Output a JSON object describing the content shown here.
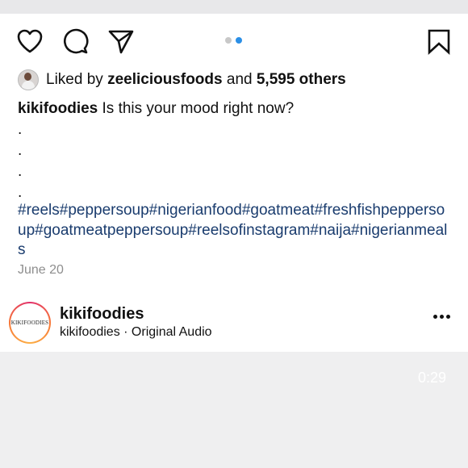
{
  "post": {
    "liked_prefix": "Liked by",
    "liked_user": "zeeliciousfoods",
    "liked_and": "and",
    "liked_count": "5,595 others",
    "caption_user": "kikifoodies",
    "caption_text": "Is this your mood right now?",
    "caption_dots": [
      ".",
      ".",
      ".",
      "."
    ],
    "hashtags": "#reels#peppersoup#nigerianfood#goatmeat#freshfishpeppersoup#goatmeatpeppersoup#reelsofinstagram#naija#nigerianmeals",
    "date": "June 20",
    "carousel": {
      "count": 2,
      "active_index": 1
    }
  },
  "reel": {
    "profile_name": "kikifoodies",
    "profile_logo_text": "KIKIFOODIES",
    "audio_text": "kikifoodies · Original Audio",
    "duration": "0:29"
  },
  "icons": [
    "heart-icon",
    "comment-icon",
    "share-icon",
    "bookmark-icon",
    "more-icon"
  ],
  "colors": {
    "hashtag": "#1a3c6e",
    "carousel_active": "#2b8fe6",
    "story_ring": "#e1306c"
  }
}
